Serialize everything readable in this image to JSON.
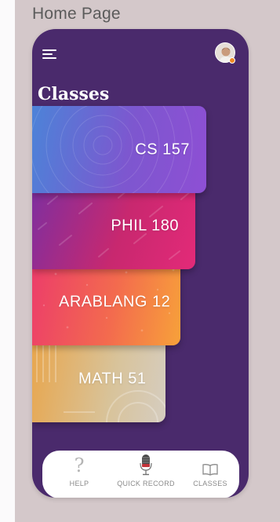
{
  "page_label": "Home Page",
  "header": {
    "title": "Classes",
    "menu_icon": "hamburger-menu-icon",
    "avatar_icon": "user-avatar",
    "status_dot_color": "#f08a24"
  },
  "classes": [
    {
      "name": "CS 157"
    },
    {
      "name": "PHIL 180"
    },
    {
      "name": "ARABLANG 12"
    },
    {
      "name": "MATH 51"
    }
  ],
  "tabbar": {
    "items": [
      {
        "label": "HELP",
        "icon": "question-mark-icon"
      },
      {
        "label": "QUICK RECORD",
        "icon": "microphone-icon"
      },
      {
        "label": "CLASSES",
        "icon": "book-icon"
      }
    ]
  },
  "colors": {
    "app_background": "#4a2a6c",
    "canvas_background": "#d4c8ca"
  }
}
